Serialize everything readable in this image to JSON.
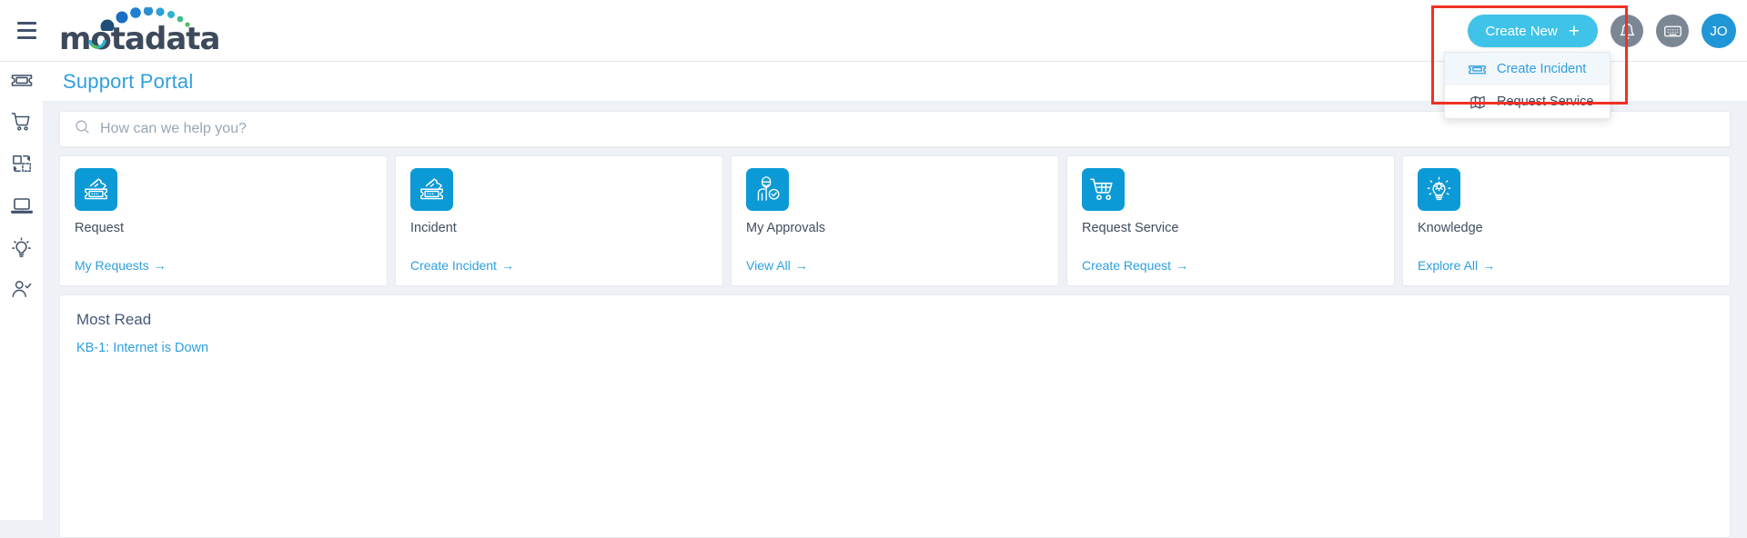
{
  "header": {
    "menu_icon": "hamburger-icon",
    "logo_text": "motadata",
    "create_new_label": "Create New",
    "create_new_plus": "+",
    "notification_icon": "bell-icon",
    "keyboard_icon": "keyboard-icon",
    "avatar_initials": "JO",
    "accent_blue": "#3fc3e8",
    "avatar_blue": "#2196d6"
  },
  "dropdown": {
    "items": [
      {
        "label": "Create Incident",
        "icon": "ticket-icon",
        "active": true
      },
      {
        "label": "Request Service",
        "icon": "map-icon",
        "active": false
      }
    ]
  },
  "sidebar": {
    "items": [
      {
        "name": "sidebar-item-tickets",
        "icon": "ticket-icon"
      },
      {
        "name": "sidebar-item-service-catalog",
        "icon": "shopping-cart-icon"
      },
      {
        "name": "sidebar-item-change",
        "icon": "swap-workflow-icon"
      },
      {
        "name": "sidebar-item-assets",
        "icon": "laptop-icon"
      },
      {
        "name": "sidebar-item-knowledge",
        "icon": "lightbulb-icon"
      },
      {
        "name": "sidebar-item-approvals",
        "icon": "user-check-icon"
      }
    ]
  },
  "page": {
    "title": "Support Portal",
    "title_color": "#2f9fe0"
  },
  "search": {
    "placeholder": "How can we help you?",
    "value": "",
    "icon": "search-icon"
  },
  "cards": [
    {
      "label": "Request",
      "icon": "tickets-stack-icon",
      "link": "My Requests",
      "arrow": "→"
    },
    {
      "label": "Incident",
      "icon": "tickets-stack-icon",
      "link": "Create Incident",
      "arrow": "→"
    },
    {
      "label": "My Approvals",
      "icon": "person-approved-icon",
      "link": "View All",
      "arrow": "→"
    },
    {
      "label": "Request Service",
      "icon": "shopping-cart-icon",
      "link": "Create Request",
      "arrow": "→"
    },
    {
      "label": "Knowledge",
      "icon": "lightbulb-gear-icon",
      "link": "Explore All",
      "arrow": "→"
    }
  ],
  "most_read": {
    "title": "Most Read",
    "articles": [
      {
        "label": "KB-1: Internet is Down"
      }
    ]
  },
  "annotation": {
    "highlight_color": "#ef3124"
  }
}
